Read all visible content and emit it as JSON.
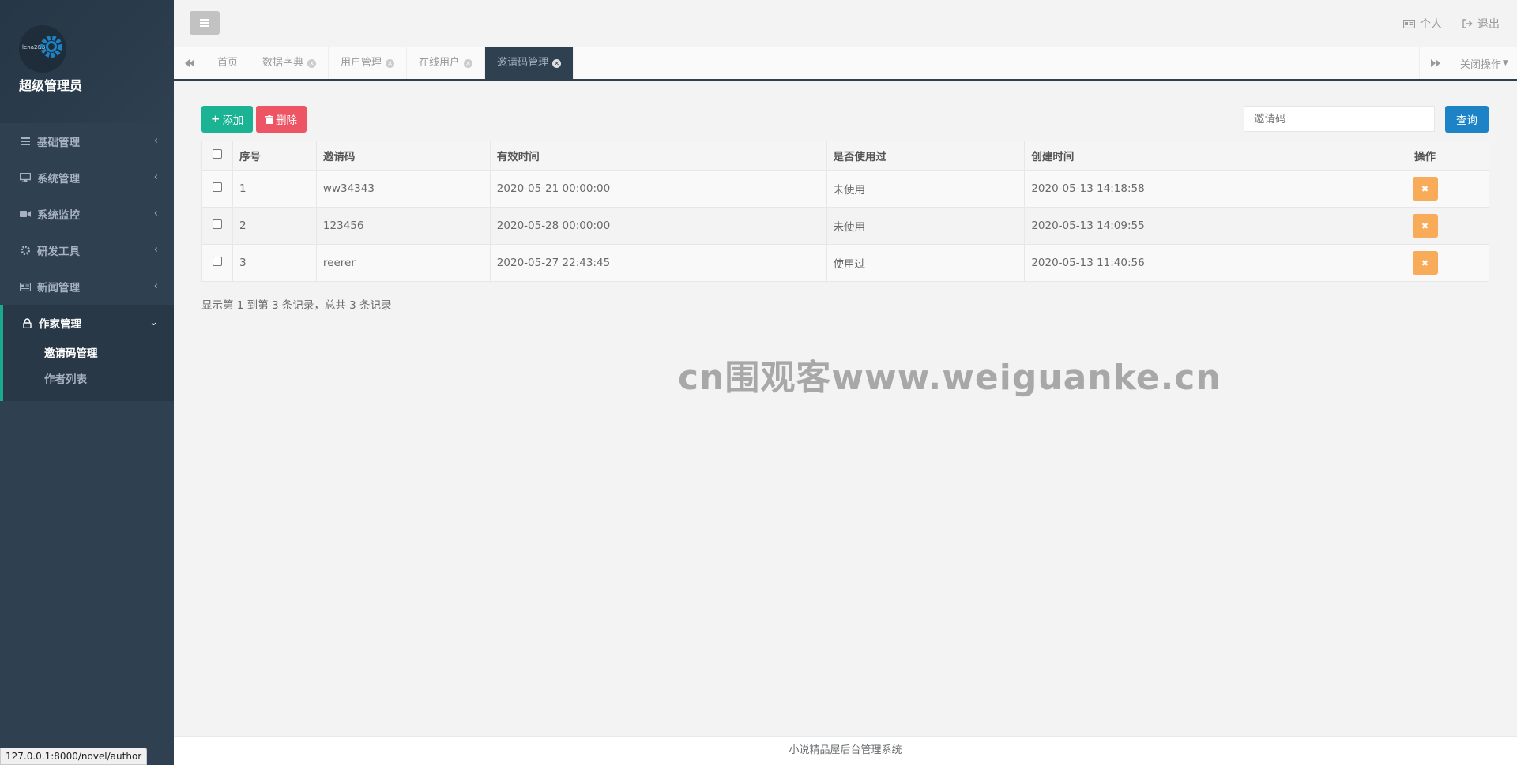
{
  "sidebar": {
    "avatar_text": "lena2&b",
    "admin_name": "超级管理员",
    "menu": [
      {
        "label": "基础管理",
        "icon": "list-icon"
      },
      {
        "label": "系统管理",
        "icon": "desktop-icon"
      },
      {
        "label": "系统监控",
        "icon": "video-icon"
      },
      {
        "label": "研发工具",
        "icon": "gear-icon"
      },
      {
        "label": "新闻管理",
        "icon": "newspaper-icon"
      }
    ],
    "active_menu": {
      "label": "作家管理",
      "icon": "lock-icon"
    },
    "submenu": [
      {
        "label": "邀请码管理",
        "active": true
      },
      {
        "label": "作者列表",
        "active": false
      }
    ]
  },
  "topbar": {
    "profile_label": "个人",
    "logout_label": "退出"
  },
  "tabs": {
    "items": [
      "首页",
      "数据字典",
      "用户管理",
      "在线用户",
      "邀请码管理"
    ],
    "close_ops_label": "关闭操作"
  },
  "toolbar": {
    "add_label": "添加",
    "delete_label": "删除",
    "search_placeholder": "邀请码",
    "search_label": "查询"
  },
  "table": {
    "headers": [
      "序号",
      "邀请码",
      "有效时间",
      "是否使用过",
      "创建时间",
      "操作"
    ],
    "rows": [
      {
        "index": "1",
        "code": "ww34343",
        "valid": "2020-05-21 00:00:00",
        "used": "未使用",
        "created": "2020-05-13 14:18:58"
      },
      {
        "index": "2",
        "code": "123456",
        "valid": "2020-05-28 00:00:00",
        "used": "未使用",
        "created": "2020-05-13 14:09:55"
      },
      {
        "index": "3",
        "code": "reerer",
        "valid": "2020-05-27 22:43:45",
        "used": "使用过",
        "created": "2020-05-13 11:40:56"
      }
    ],
    "summary": "显示第 1 到第 3 条记录，总共 3 条记录"
  },
  "watermark": "cn围观客www.weiguanke.cn",
  "footer": "小说精品屋后台管理系统",
  "statusbar": "127.0.0.1:8000/novel/author",
  "colors": {
    "sidebar_bg": "#2f4050",
    "accent_green": "#1ab394",
    "danger_red": "#ed5565",
    "primary_blue": "#1c84c6",
    "warning_orange": "#f8ac59"
  }
}
